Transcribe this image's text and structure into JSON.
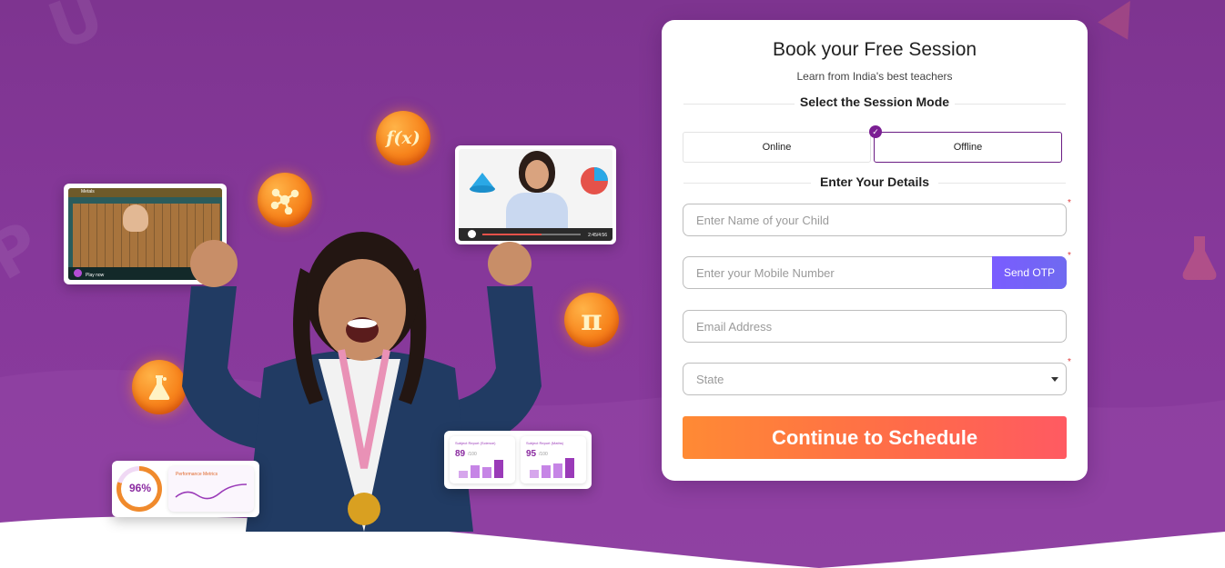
{
  "form": {
    "title": "Book your Free Session",
    "subtitle": "Learn from India's best teachers",
    "session_mode_heading": "Select the Session Mode",
    "modes": [
      {
        "label": "Online",
        "selected": false
      },
      {
        "label": "Offline",
        "selected": true
      }
    ],
    "details_heading": "Enter Your Details",
    "child_name": {
      "placeholder": "Enter Name of your Child",
      "value": "",
      "required": true
    },
    "mobile": {
      "placeholder": "Enter your Mobile Number",
      "value": "",
      "required": true
    },
    "send_otp_label": "Send OTP",
    "email": {
      "placeholder": "Email Address",
      "value": "",
      "required": false
    },
    "state": {
      "placeholder": "State",
      "value": "",
      "required": true
    },
    "cta_label": "Continue to Schedule",
    "required_mark": "*"
  },
  "hero": {
    "badges": [
      "f(x)",
      "π"
    ],
    "video_card_time": "2:45/4:56",
    "lesson_card_label": "Play now",
    "lesson_card_title": "Metals",
    "performance": {
      "percent": "96%",
      "title": "Performance Metrics"
    },
    "reports": [
      {
        "title": "Subject Report (Science)",
        "score": "89",
        "out_of": "/100"
      },
      {
        "title": "Subject Report (Maths)",
        "score": "95",
        "out_of": "/100"
      }
    ]
  },
  "colors": {
    "background": "#86389a",
    "accent": "#7b1f93",
    "cta_start": "#ff8a34",
    "cta_end": "#ff5a62",
    "otp": "#7a5cff"
  }
}
